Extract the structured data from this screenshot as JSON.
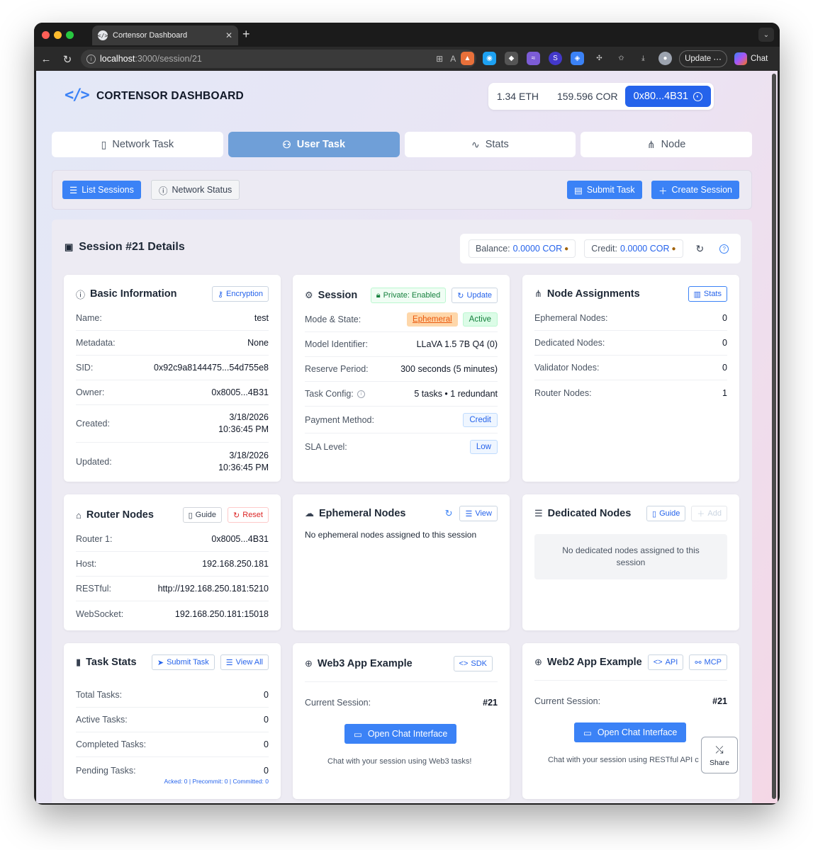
{
  "browser": {
    "tab_title": "Cortensor Dashboard",
    "url_host": "localhost",
    "url_path": ":3000/session/21",
    "update_label": "Update",
    "chat_label": "Chat"
  },
  "header": {
    "brand": "CORTENSOR DASHBOARD",
    "eth_balance": "1.34 ETH",
    "cor_balance": "159.596 COR",
    "wallet_address": "0x80...4B31"
  },
  "tabs": [
    {
      "label": "Network Task",
      "active": false
    },
    {
      "label": "User Task",
      "active": true
    },
    {
      "label": "Stats",
      "active": false
    },
    {
      "label": "Node",
      "active": false
    }
  ],
  "actions": {
    "list_sessions": "List Sessions",
    "network_status": "Network Status",
    "submit_task": "Submit Task",
    "create_session": "Create Session"
  },
  "session_panel": {
    "title": "Session #21 Details",
    "balance_label": "Balance:",
    "balance_value": "0.0000 COR",
    "credit_label": "Credit:",
    "credit_value": "0.0000 COR"
  },
  "basic_info": {
    "title": "Basic Information",
    "chip": "Encryption",
    "rows": [
      {
        "k": "Name:",
        "v": "test"
      },
      {
        "k": "Metadata:",
        "v": "None"
      },
      {
        "k": "SID:",
        "v": "0x92c9a8144475...54d755e8"
      },
      {
        "k": "Owner:",
        "v": "0x8005...4B31"
      },
      {
        "k": "Created:",
        "v1": "3/18/2026",
        "v2": "10:36:45 PM"
      },
      {
        "k": "Updated:",
        "v1": "3/18/2026",
        "v2": "10:36:45 PM"
      }
    ]
  },
  "session_card": {
    "title": "Session",
    "private_chip": "Private: Enabled",
    "update_chip": "Update",
    "mode_label": "Mode & State:",
    "mode_tag": "Ephemeral",
    "state_tag": "Active",
    "model_label": "Model Identifier:",
    "model_value": "LLaVA 1.5 7B Q4 (0)",
    "reserve_label": "Reserve Period:",
    "reserve_value": "300 seconds (5 minutes)",
    "task_config_label": "Task Config:",
    "task_config_value": "5 tasks • 1 redundant",
    "payment_label": "Payment Method:",
    "payment_value": "Credit",
    "sla_label": "SLA Level:",
    "sla_value": "Low"
  },
  "node_assignments": {
    "title": "Node Assignments",
    "chip": "Stats",
    "rows": [
      {
        "k": "Ephemeral Nodes:",
        "v": "0"
      },
      {
        "k": "Dedicated Nodes:",
        "v": "0"
      },
      {
        "k": "Validator Nodes:",
        "v": "0"
      },
      {
        "k": "Router Nodes:",
        "v": "1"
      }
    ]
  },
  "router_nodes": {
    "title": "Router Nodes",
    "guide": "Guide",
    "reset": "Reset",
    "rows": [
      {
        "k": "Router 1:",
        "v": "0x8005...4B31"
      },
      {
        "k": "Host:",
        "v": "192.168.250.181"
      },
      {
        "k": "RESTful:",
        "v": "http://192.168.250.181:5210"
      },
      {
        "k": "WebSocket:",
        "v": "192.168.250.181:15018"
      }
    ]
  },
  "ephemeral_nodes": {
    "title": "Ephemeral Nodes",
    "view": "View",
    "empty": "No ephemeral nodes assigned to this session"
  },
  "dedicated_nodes": {
    "title": "Dedicated Nodes",
    "guide": "Guide",
    "add": "Add",
    "empty": "No dedicated nodes assigned to this session"
  },
  "task_stats": {
    "title": "Task Stats",
    "submit": "Submit Task",
    "view_all": "View All",
    "rows": [
      {
        "k": "Total Tasks:",
        "v": "0"
      },
      {
        "k": "Active Tasks:",
        "v": "0"
      },
      {
        "k": "Completed Tasks:",
        "v": "0"
      },
      {
        "k": "Pending Tasks:",
        "v": "0"
      }
    ],
    "pending_detail": "Acked: 0 | Precommit: 0 | Committed: 0"
  },
  "web3": {
    "title": "Web3 App Example",
    "chip": "SDK",
    "session_label": "Current Session:",
    "session_value": "#21",
    "button": "Open Chat Interface",
    "note": "Chat with your session using Web3 tasks!"
  },
  "web2": {
    "title": "Web2 App Example",
    "api": "API",
    "mcp": "MCP",
    "session_label": "Current Session:",
    "session_value": "#21",
    "button": "Open Chat Interface",
    "note": "Chat with your session using RESTful API c"
  },
  "share_label": "Share"
}
